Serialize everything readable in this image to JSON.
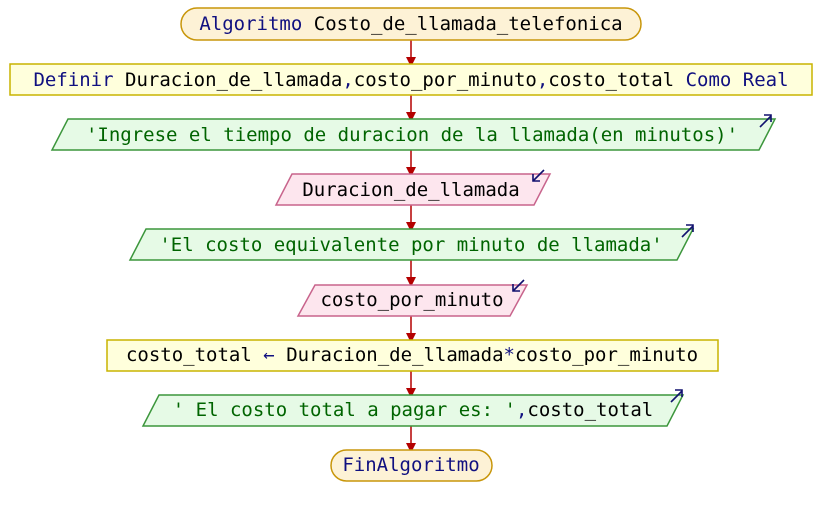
{
  "colors": {
    "terminal_fill": "#fdf2d6",
    "terminal_stroke": "#c8960a",
    "process_fill": "#ffffdc",
    "process_stroke": "#c8b400",
    "output_fill": "#e6fae6",
    "output_stroke": "#3c963c",
    "input_fill": "#fde6ee",
    "input_stroke": "#c8648c",
    "arrow": "#b40000",
    "io_icon": "#10106e",
    "keyword": "#101080",
    "string": "#006400",
    "identifier": "#000000"
  },
  "flow": {
    "start": {
      "keyword": "Algoritmo",
      "name": "Costo_de_llamada_telefonica"
    },
    "define": {
      "keyword": "Definir",
      "var1": "Duracion_de_llamada",
      "sep1": ",",
      "var2": "costo_por_minuto",
      "sep2": ",",
      "var3": "costo_total",
      "type_keyword": "Como Real"
    },
    "write1": {
      "text": "'Ingrese el tiempo de duracion de la llamada(en minutos)'",
      "icon": "output-arrow-icon"
    },
    "read1": {
      "text": "Duracion_de_llamada",
      "icon": "input-arrow-icon"
    },
    "write2": {
      "text": "'El costo equivalente por minuto de llamada'",
      "icon": "output-arrow-icon"
    },
    "read2": {
      "text": "costo_por_minuto",
      "icon": "input-arrow-icon"
    },
    "assign": {
      "target": "costo_total",
      "arrow": "←",
      "operand1": "Duracion_de_llamada",
      "operator": "*",
      "operand2": "costo_por_minuto"
    },
    "write3": {
      "string": "' El costo total a pagar es: '",
      "sep": ",",
      "var": "costo_total",
      "icon": "output-arrow-icon"
    },
    "end": {
      "keyword": "FinAlgoritmo"
    }
  }
}
